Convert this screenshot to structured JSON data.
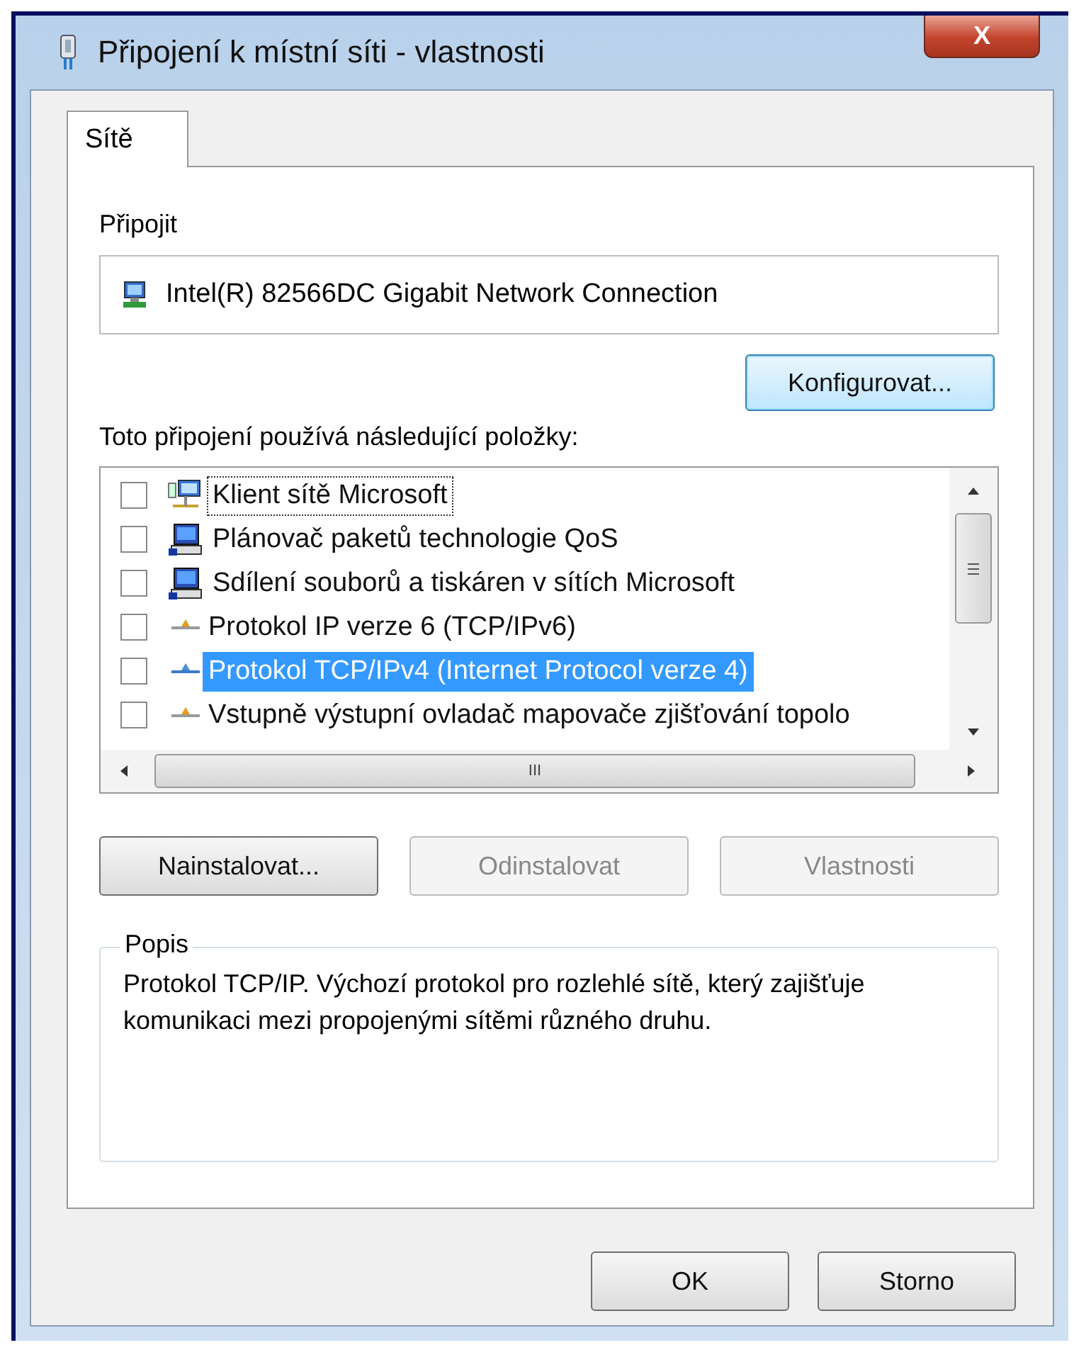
{
  "window": {
    "title": "Připojení k místní síti - vlastnosti",
    "close": "X"
  },
  "tabs": [
    {
      "label": "Sítě",
      "selected": true
    }
  ],
  "connect": {
    "label": "Připojit",
    "adapter": "Intel(R) 82566DC Gigabit Network Connection",
    "configure": "Konfigurovat..."
  },
  "items_label": "Toto připojení používá následující položky:",
  "items": [
    {
      "label": "Klient sítě Microsoft",
      "kind": "client",
      "checked": false,
      "selected": false,
      "focused": true
    },
    {
      "label": "Plánovač paketů technologie QoS",
      "kind": "service",
      "checked": false,
      "selected": false,
      "focused": false
    },
    {
      "label": "Sdílení souborů a tiskáren v sítích Microsoft",
      "kind": "service",
      "checked": false,
      "selected": false,
      "focused": false
    },
    {
      "label": "Protokol IP verze 6 (TCP/IPv6)",
      "kind": "protocol",
      "checked": false,
      "selected": false,
      "focused": false
    },
    {
      "label": "Protokol TCP/IPv4 (Internet Protocol verze 4)",
      "kind": "protocol",
      "checked": false,
      "selected": true,
      "focused": false
    },
    {
      "label": "Vstupně výstupní ovladač mapovače zjišťování topolo",
      "kind": "protocol",
      "checked": false,
      "selected": false,
      "focused": false
    }
  ],
  "scroll_thumb": "III",
  "actions": [
    {
      "label": "Nainstalovat...",
      "disabled": false
    },
    {
      "label": "Odinstalovat",
      "disabled": true
    },
    {
      "label": "Vlastnosti",
      "disabled": true
    }
  ],
  "description": {
    "title": "Popis",
    "text": "Protokol TCP/IP. Výchozí protokol pro rozlehlé sítě, který zajišťuje komunikaci mezi propojenými sítěmi různého druhu."
  },
  "buttons": [
    "OK",
    "Storno"
  ]
}
